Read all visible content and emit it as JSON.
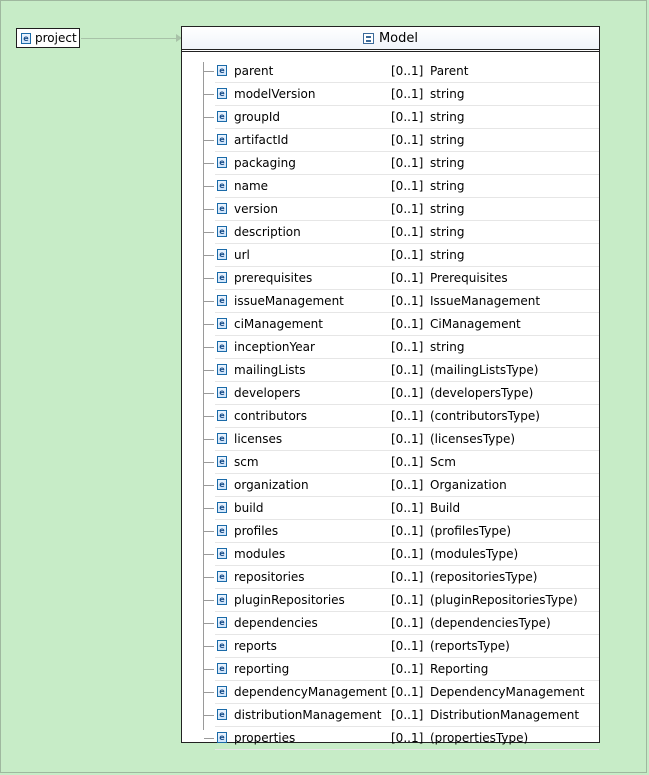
{
  "root": {
    "label": "project"
  },
  "model": {
    "title": "Model",
    "elements": [
      {
        "name": "parent",
        "card": "[0..1]",
        "type": "Parent"
      },
      {
        "name": "modelVersion",
        "card": "[0..1]",
        "type": "string"
      },
      {
        "name": "groupId",
        "card": "[0..1]",
        "type": "string"
      },
      {
        "name": "artifactId",
        "card": "[0..1]",
        "type": "string"
      },
      {
        "name": "packaging",
        "card": "[0..1]",
        "type": "string"
      },
      {
        "name": "name",
        "card": "[0..1]",
        "type": "string"
      },
      {
        "name": "version",
        "card": "[0..1]",
        "type": "string"
      },
      {
        "name": "description",
        "card": "[0..1]",
        "type": "string"
      },
      {
        "name": "url",
        "card": "[0..1]",
        "type": "string"
      },
      {
        "name": "prerequisites",
        "card": "[0..1]",
        "type": "Prerequisites"
      },
      {
        "name": "issueManagement",
        "card": "[0..1]",
        "type": "IssueManagement"
      },
      {
        "name": "ciManagement",
        "card": "[0..1]",
        "type": "CiManagement"
      },
      {
        "name": "inceptionYear",
        "card": "[0..1]",
        "type": "string"
      },
      {
        "name": "mailingLists",
        "card": "[0..1]",
        "type": "(mailingListsType)"
      },
      {
        "name": "developers",
        "card": "[0..1]",
        "type": "(developersType)"
      },
      {
        "name": "contributors",
        "card": "[0..1]",
        "type": "(contributorsType)"
      },
      {
        "name": "licenses",
        "card": "[0..1]",
        "type": "(licensesType)"
      },
      {
        "name": "scm",
        "card": "[0..1]",
        "type": "Scm"
      },
      {
        "name": "organization",
        "card": "[0..1]",
        "type": "Organization"
      },
      {
        "name": "build",
        "card": "[0..1]",
        "type": "Build"
      },
      {
        "name": "profiles",
        "card": "[0..1]",
        "type": "(profilesType)"
      },
      {
        "name": "modules",
        "card": "[0..1]",
        "type": "(modulesType)"
      },
      {
        "name": "repositories",
        "card": "[0..1]",
        "type": "(repositoriesType)"
      },
      {
        "name": "pluginRepositories",
        "card": "[0..1]",
        "type": "(pluginRepositoriesType)"
      },
      {
        "name": "dependencies",
        "card": "[0..1]",
        "type": "(dependenciesType)"
      },
      {
        "name": "reports",
        "card": "[0..1]",
        "type": "(reportsType)"
      },
      {
        "name": "reporting",
        "card": "[0..1]",
        "type": "Reporting"
      },
      {
        "name": "dependencyManagement",
        "card": "[0..1]",
        "type": "DependencyManagement"
      },
      {
        "name": "distributionManagement",
        "card": "[0..1]",
        "type": "DistributionManagement"
      },
      {
        "name": "properties",
        "card": "[0..1]",
        "type": "(propertiesType)"
      }
    ]
  },
  "icons": {
    "element": "element-icon",
    "complex_type": "complex-type-icon",
    "sequence": "sequence-compositor-icon"
  },
  "colors": {
    "background": "#c7ecc7",
    "box": "#ffffff",
    "border": "#222222",
    "icon_accent": "#1a6aa8"
  }
}
